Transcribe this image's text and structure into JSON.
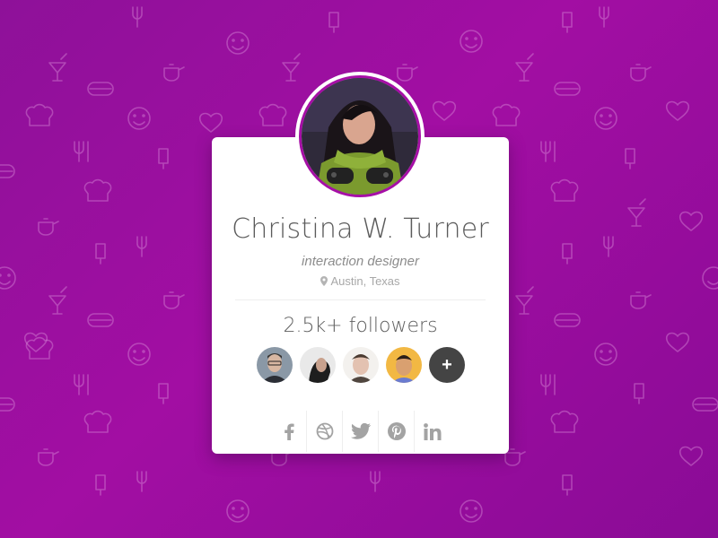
{
  "profile": {
    "name": "Christina W. Turner",
    "role": "interaction designer",
    "location": "Austin, Texas"
  },
  "followers": {
    "label": "2.5k+ followers",
    "more_label": "+",
    "avatars": [
      {
        "name": "follower-avatar-1"
      },
      {
        "name": "follower-avatar-2"
      },
      {
        "name": "follower-avatar-3"
      },
      {
        "name": "follower-avatar-4"
      }
    ]
  },
  "social": [
    "facebook-icon",
    "dribbble-icon",
    "twitter-icon",
    "pinterest-icon",
    "linkedin-icon"
  ],
  "colors": {
    "accent": "#a60fa6",
    "background_start": "#8e1199",
    "background_end": "#8a0b96",
    "card": "#ffffff",
    "icon": "#a3a3a3",
    "more_button": "#444444"
  },
  "background_pattern_icons": [
    "heart-icon",
    "smiley-icon",
    "cocktail-icon",
    "teapot-icon",
    "hotdog-icon",
    "chef-hat-icon",
    "cutlery-icon",
    "popsicle-icon"
  ]
}
